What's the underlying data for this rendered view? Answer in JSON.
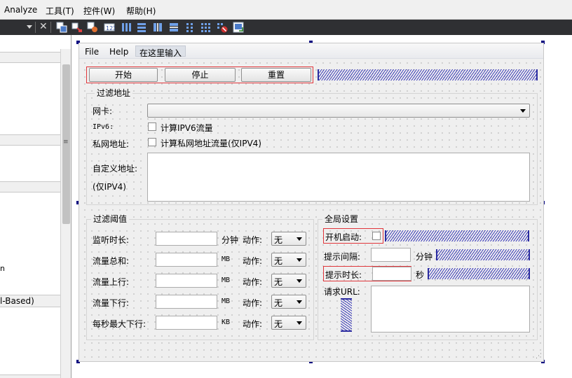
{
  "menubar": {
    "items": [
      "Analyze",
      "工具(T)",
      "控件(W)",
      "帮助(H)"
    ]
  },
  "toolbar": {
    "close_glyph": "✕",
    "icons": [
      "edit-widgets-icon",
      "edit-signals-slots-icon",
      "edit-buddies-icon",
      "edit-tab-order-icon",
      "layout-horizontal-icon",
      "layout-vertical-icon",
      "layout-horizontal-splitter-icon",
      "layout-vertical-splitter-icon",
      "layout-form-icon",
      "layout-grid-icon",
      "break-layout-icon",
      "adjust-size-icon"
    ]
  },
  "side_panel": {
    "partial_texts": [
      "n",
      "l-Based)"
    ],
    "grip": "≡"
  },
  "form": {
    "menubar": {
      "file": "File",
      "help": "Help",
      "placeholder": "在这里输入"
    },
    "buttons": {
      "start": "开始",
      "stop": "停止",
      "reset": "重置"
    },
    "filter_address": {
      "title": "过滤地址",
      "nic_label": "网卡:",
      "nic_value": "",
      "ipv6_label": "IPv6:",
      "ipv6_check": "计算IPV6流量",
      "private_label": "私网地址:",
      "private_check": "计算私网地址流量(仅IPV4)",
      "custom_label": "自定义地址:",
      "custom_note": "(仅IPV4)"
    },
    "filter_threshold": {
      "title": "过滤阈值",
      "action_label": "动作:",
      "rows": [
        {
          "label": "监听时长:",
          "unit": "分钟",
          "action": "无"
        },
        {
          "label": "流量总和:",
          "unit": "MB",
          "action": "无"
        },
        {
          "label": "流量上行:",
          "unit": "MB",
          "action": "无"
        },
        {
          "label": "流量下行:",
          "unit": "MB",
          "action": "无"
        },
        {
          "label": "每秒最大下行:",
          "unit": "KB",
          "action": "无"
        }
      ]
    },
    "global_settings": {
      "title": "全局设置",
      "autostart_label": "开机启动:",
      "interval_label": "提示间隔:",
      "interval_unit": "分钟",
      "duration_label": "提示时长:",
      "duration_unit": "秒",
      "url_label": "请求URL:"
    }
  }
}
